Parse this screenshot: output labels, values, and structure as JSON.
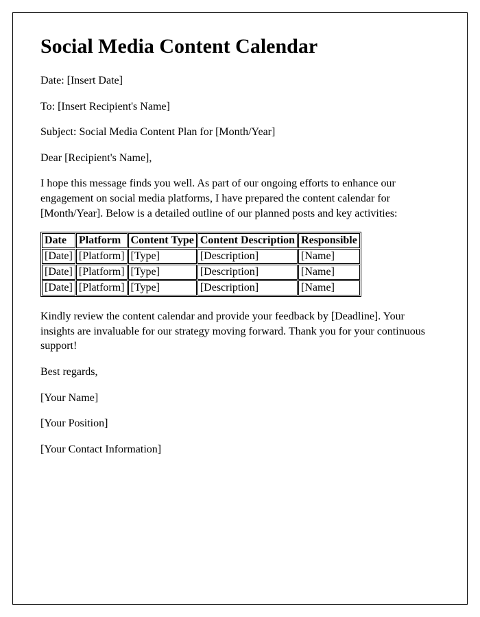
{
  "title": "Social Media Content Calendar",
  "date_line": "Date: [Insert Date]",
  "to_line": "To: [Insert Recipient's Name]",
  "subject_line": "Subject: Social Media Content Plan for [Month/Year]",
  "salutation": "Dear [Recipient's Name],",
  "intro_paragraph": "I hope this message finds you well. As part of our ongoing efforts to enhance our engagement on social media platforms, I have prepared the content calendar for [Month/Year]. Below is a detailed outline of our planned posts and key activities:",
  "table": {
    "headers": [
      "Date",
      "Platform",
      "Content Type",
      "Content Description",
      "Responsible"
    ],
    "rows": [
      [
        "[Date]",
        "[Platform]",
        "[Type]",
        "[Description]",
        "[Name]"
      ],
      [
        "[Date]",
        "[Platform]",
        "[Type]",
        "[Description]",
        "[Name]"
      ],
      [
        "[Date]",
        "[Platform]",
        "[Type]",
        "[Description]",
        "[Name]"
      ]
    ]
  },
  "closing_paragraph": "Kindly review the content calendar and provide your feedback by [Deadline]. Your insights are invaluable for our strategy moving forward. Thank you for your continuous support!",
  "signoff": "Best regards,",
  "sender_name": "[Your Name]",
  "sender_position": "[Your Position]",
  "sender_contact": "[Your Contact Information]"
}
